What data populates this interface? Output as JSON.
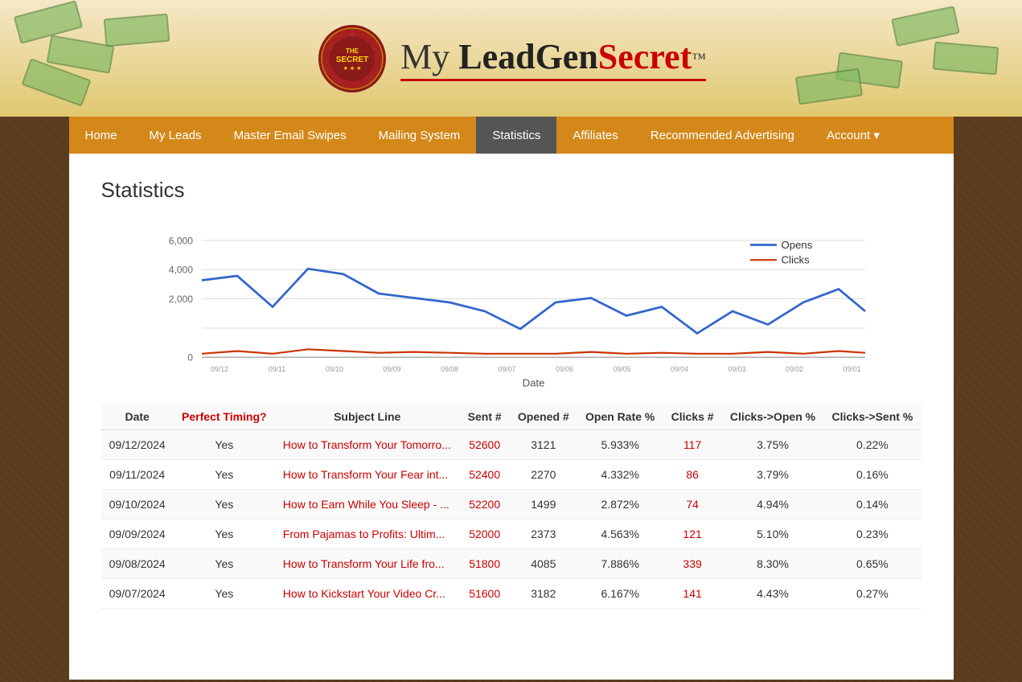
{
  "header": {
    "brand_my": "My ",
    "brand_leadgen": "LeadGen",
    "brand_secret": "Secret",
    "brand_tm": "™"
  },
  "nav": {
    "items": [
      {
        "label": "Home",
        "id": "home",
        "active": false
      },
      {
        "label": "My Leads",
        "id": "my-leads",
        "active": false
      },
      {
        "label": "Master Email Swipes",
        "id": "master-email-swipes",
        "active": false
      },
      {
        "label": "Mailing System",
        "id": "mailing-system",
        "active": false
      },
      {
        "label": "Statistics",
        "id": "statistics",
        "active": true
      },
      {
        "label": "Affiliates",
        "id": "affiliates",
        "active": false
      },
      {
        "label": "Recommended Advertising",
        "id": "recommended-advertising",
        "active": false
      },
      {
        "label": "Account ▾",
        "id": "account",
        "active": false
      }
    ]
  },
  "page": {
    "title": "Statistics"
  },
  "chart": {
    "y_labels": [
      "6,000",
      "4,000",
      "2,000",
      "0"
    ],
    "x_label": "Date",
    "legend": {
      "opens_label": "Opens",
      "clicks_label": "Clicks",
      "opens_color": "#3366cc",
      "clicks_color": "#cc3300"
    }
  },
  "table": {
    "columns": [
      "Date",
      "Perfect Timing?",
      "Subject Line",
      "Sent #",
      "Opened #",
      "Open Rate %",
      "Clicks #",
      "Clicks->Open %",
      "Clicks->Sent %"
    ],
    "rows": [
      {
        "date": "09/12/2024",
        "perfect_timing": "Yes",
        "subject": "How to Transform Your Tomorro...",
        "sent": "52600",
        "opened": "3121",
        "open_rate": "5.933%",
        "clicks": "117",
        "clicks_open": "3.75%",
        "clicks_sent": "0.22%"
      },
      {
        "date": "09/11/2024",
        "perfect_timing": "Yes",
        "subject": "How to Transform Your Fear int...",
        "sent": "52400",
        "opened": "2270",
        "open_rate": "4.332%",
        "clicks": "86",
        "clicks_open": "3.79%",
        "clicks_sent": "0.16%"
      },
      {
        "date": "09/10/2024",
        "perfect_timing": "Yes",
        "subject": "How to Earn While You Sleep - ...",
        "sent": "52200",
        "opened": "1499",
        "open_rate": "2.872%",
        "clicks": "74",
        "clicks_open": "4.94%",
        "clicks_sent": "0.14%"
      },
      {
        "date": "09/09/2024",
        "perfect_timing": "Yes",
        "subject": "From Pajamas to Profits: Ultim...",
        "sent": "52000",
        "opened": "2373",
        "open_rate": "4.563%",
        "clicks": "121",
        "clicks_open": "5.10%",
        "clicks_sent": "0.23%"
      },
      {
        "date": "09/08/2024",
        "perfect_timing": "Yes",
        "subject": "How to Transform Your Life fro...",
        "sent": "51800",
        "opened": "4085",
        "open_rate": "7.886%",
        "clicks": "339",
        "clicks_open": "8.30%",
        "clicks_sent": "0.65%"
      },
      {
        "date": "09/07/2024",
        "perfect_timing": "Yes",
        "subject": "How to Kickstart Your Video Cr...",
        "sent": "51600",
        "opened": "3182",
        "open_rate": "6.167%",
        "clicks": "141",
        "clicks_open": "4.43%",
        "clicks_sent": "0.27%"
      }
    ]
  }
}
